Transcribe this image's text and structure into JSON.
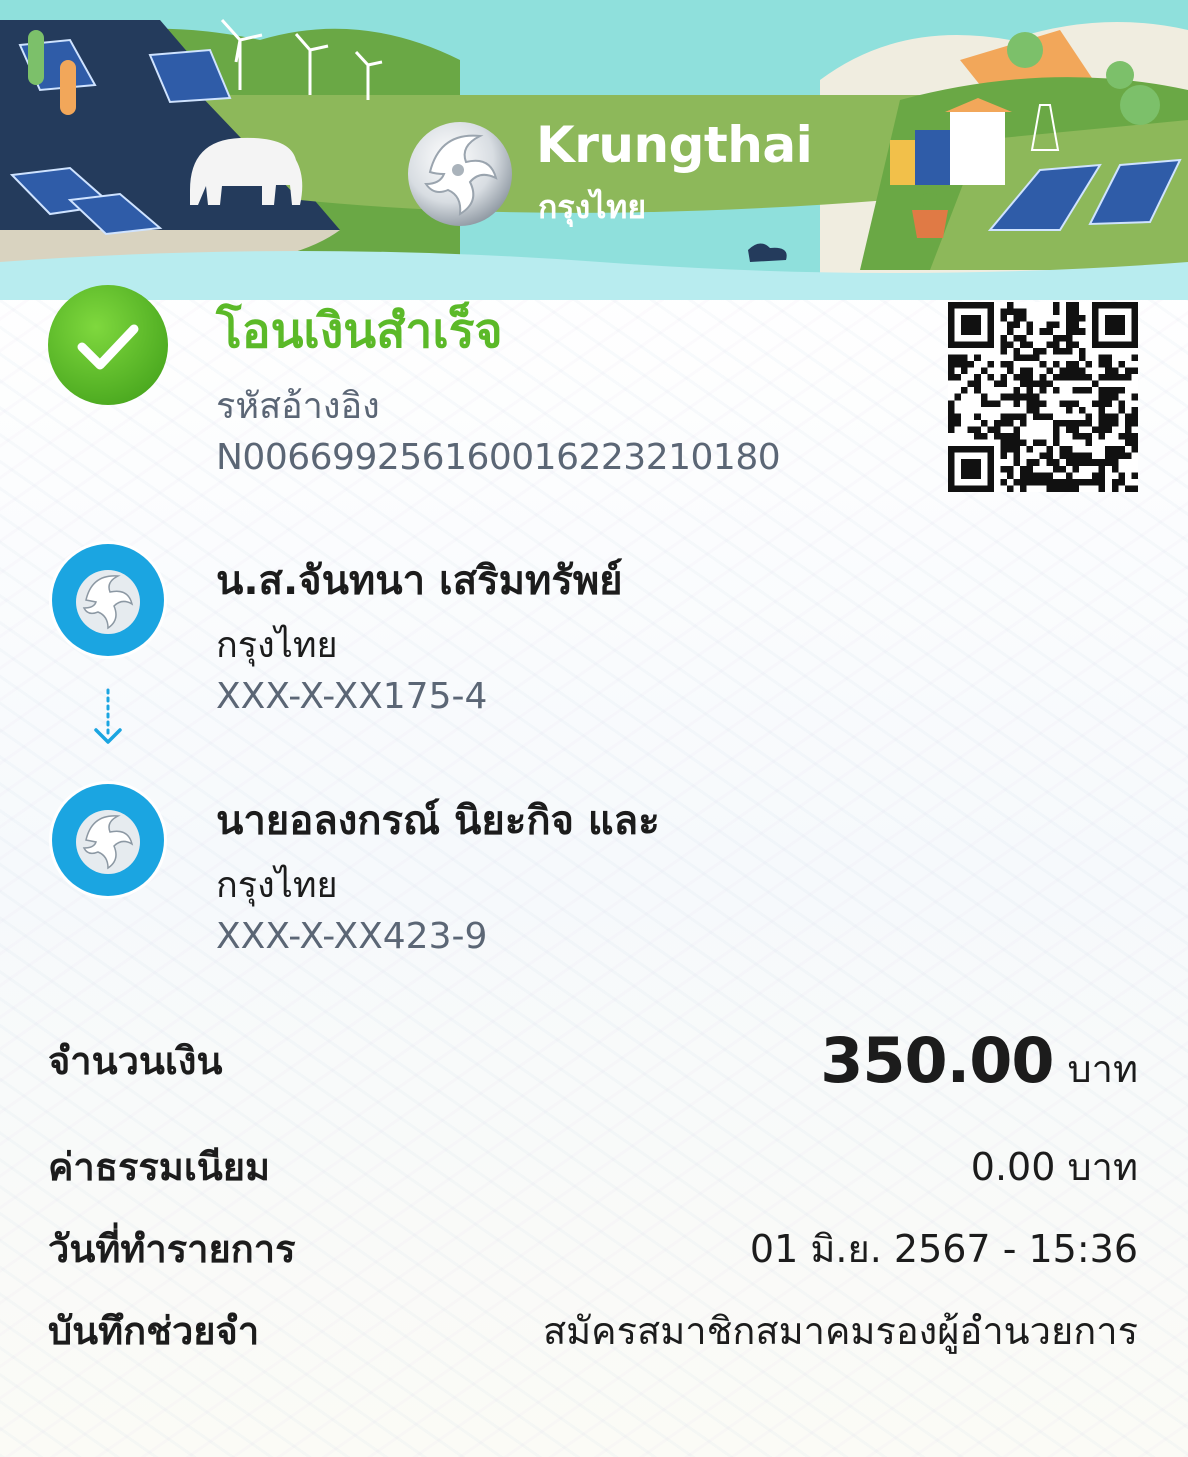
{
  "header": {
    "brand_name_en": "Krungthai",
    "brand_name_th": "กรุงไทย"
  },
  "status": {
    "title": "โอนเงินสำเร็จ",
    "reference_label": "รหัสอ้างอิง",
    "reference_value": "N006699256160016223210180"
  },
  "sender": {
    "name": "น.ส.จันทนา เสริมทรัพย์",
    "bank": "กรุงไทย",
    "account": "XXX-X-XX175-4"
  },
  "receiver": {
    "name": "นายอลงกรณ์ นิยะกิจ และ",
    "bank": "กรุงไทย",
    "account": "XXX-X-XX423-9"
  },
  "details": {
    "amount_label": "จำนวนเงิน",
    "amount_value": "350.00",
    "amount_unit": "บาท",
    "fee_label": "ค่าธรรมเนียม",
    "fee_value": "0.00 บาท",
    "date_label": "วันที่ทำรายการ",
    "date_value": "01 มิ.ย. 2567 - 15:36",
    "memo_label": "บันทึกช่วยจำ",
    "memo_value": "สมัครสมาชิกสมาคมรองผู้อำนวยการ"
  },
  "colors": {
    "success_green": "#5bb928",
    "bank_blue": "#1ba5e1",
    "secondary_text": "#5b6675"
  },
  "icons": {
    "status": "check-circle-icon",
    "bank": "krungthai-phoenix-icon",
    "transfer_direction": "dotted-arrow-down-icon",
    "verification": "qr-code-icon"
  }
}
